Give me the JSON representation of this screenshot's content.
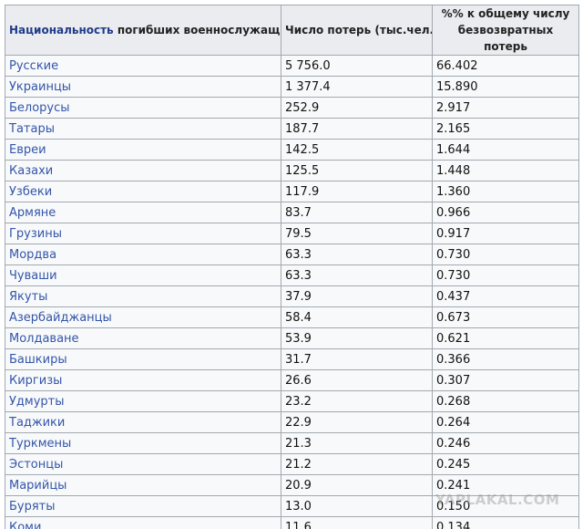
{
  "table": {
    "header": {
      "nationality_link": "Национальность",
      "nationality_rest": " погибших военнослужащих",
      "losses": "Число потерь (тыс.чел.)",
      "percent": "%% к общему числу безвозвратных потерь"
    },
    "rows": [
      {
        "nationality": "Русские",
        "losses": "5 756.0",
        "percent": "66.402"
      },
      {
        "nationality": "Украинцы",
        "losses": "1 377.4",
        "percent": "15.890"
      },
      {
        "nationality": "Белорусы",
        "losses": "252.9",
        "percent": "2.917"
      },
      {
        "nationality": "Татары",
        "losses": "187.7",
        "percent": "2.165"
      },
      {
        "nationality": "Евреи",
        "losses": "142.5",
        "percent": "1.644"
      },
      {
        "nationality": "Казахи",
        "losses": "125.5",
        "percent": "1.448"
      },
      {
        "nationality": "Узбеки",
        "losses": "117.9",
        "percent": "1.360"
      },
      {
        "nationality": "Армяне",
        "losses": "83.7",
        "percent": "0.966"
      },
      {
        "nationality": "Грузины",
        "losses": "79.5",
        "percent": "0.917"
      },
      {
        "nationality": "Мордва",
        "losses": "63.3",
        "percent": "0.730"
      },
      {
        "nationality": "Чуваши",
        "losses": "63.3",
        "percent": "0.730"
      },
      {
        "nationality": "Якуты",
        "losses": "37.9",
        "percent": "0.437"
      },
      {
        "nationality": "Азербайджанцы",
        "losses": "58.4",
        "percent": "0.673"
      },
      {
        "nationality": "Молдаване",
        "losses": "53.9",
        "percent": "0.621"
      },
      {
        "nationality": "Башкиры",
        "losses": "31.7",
        "percent": "0.366"
      },
      {
        "nationality": "Киргизы",
        "losses": "26.6",
        "percent": "0.307"
      },
      {
        "nationality": "Удмурты",
        "losses": "23.2",
        "percent": "0.268"
      },
      {
        "nationality": "Таджики",
        "losses": "22.9",
        "percent": "0.264"
      },
      {
        "nationality": "Туркмены",
        "losses": "21.3",
        "percent": "0.246"
      },
      {
        "nationality": "Эстонцы",
        "losses": "21.2",
        "percent": "0.245"
      },
      {
        "nationality": "Марийцы",
        "losses": "20.9",
        "percent": "0.241"
      },
      {
        "nationality": "Буряты",
        "losses": "13.0",
        "percent": "0.150"
      },
      {
        "nationality": "Коми",
        "losses": "11.6",
        "percent": "0.134"
      }
    ]
  },
  "watermark": "YAPLAKAL.COM"
}
